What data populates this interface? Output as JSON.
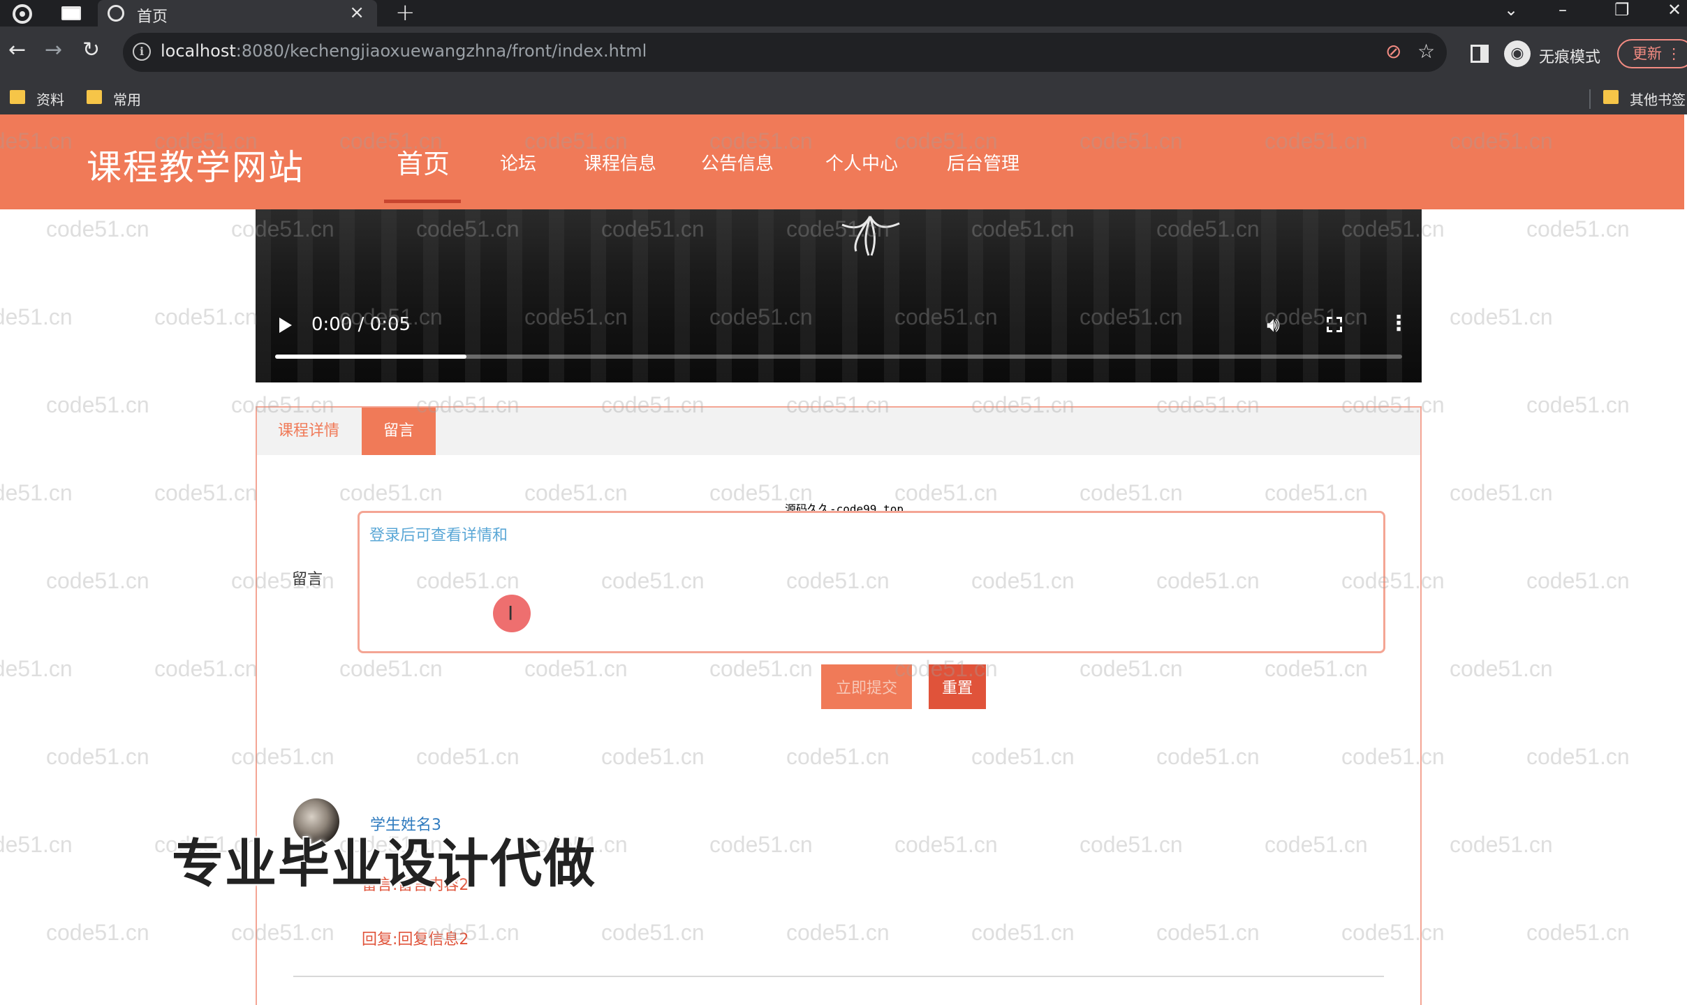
{
  "browser": {
    "tab_title": "首页",
    "tab_close": "×",
    "new_tab": "+",
    "url_host": "localhost",
    "url_rest": ":8080/kechengjiaoxuewangzhna/front/index.html",
    "incognito_label": "无痕模式",
    "update_label": "更新",
    "bookmarks": [
      "资料",
      "常用"
    ],
    "other_bookmarks": "其他书签"
  },
  "site": {
    "title": "课程教学网站",
    "nav": [
      "首页",
      "论坛",
      "课程信息",
      "公告信息",
      "个人中心",
      "后台管理"
    ]
  },
  "video": {
    "time": "0:00 / 0:05",
    "progress": 0.17
  },
  "tabs": {
    "detail": "课程详情",
    "message": "留言"
  },
  "notice": "源码久久-code99.top",
  "form": {
    "label": "留言",
    "value": "登录后可查看详情和",
    "submit": "立即提交",
    "reset": "重置"
  },
  "comment": {
    "user": "学生姓名3",
    "content": "留言:留言内容2",
    "reply": "回复:回复信息2"
  },
  "overlay": {
    "watermark": "code51.cn",
    "promo": "专业毕业设计代做"
  },
  "colors": {
    "brand": "#f07a58",
    "accent_dark": "#e0533a"
  }
}
